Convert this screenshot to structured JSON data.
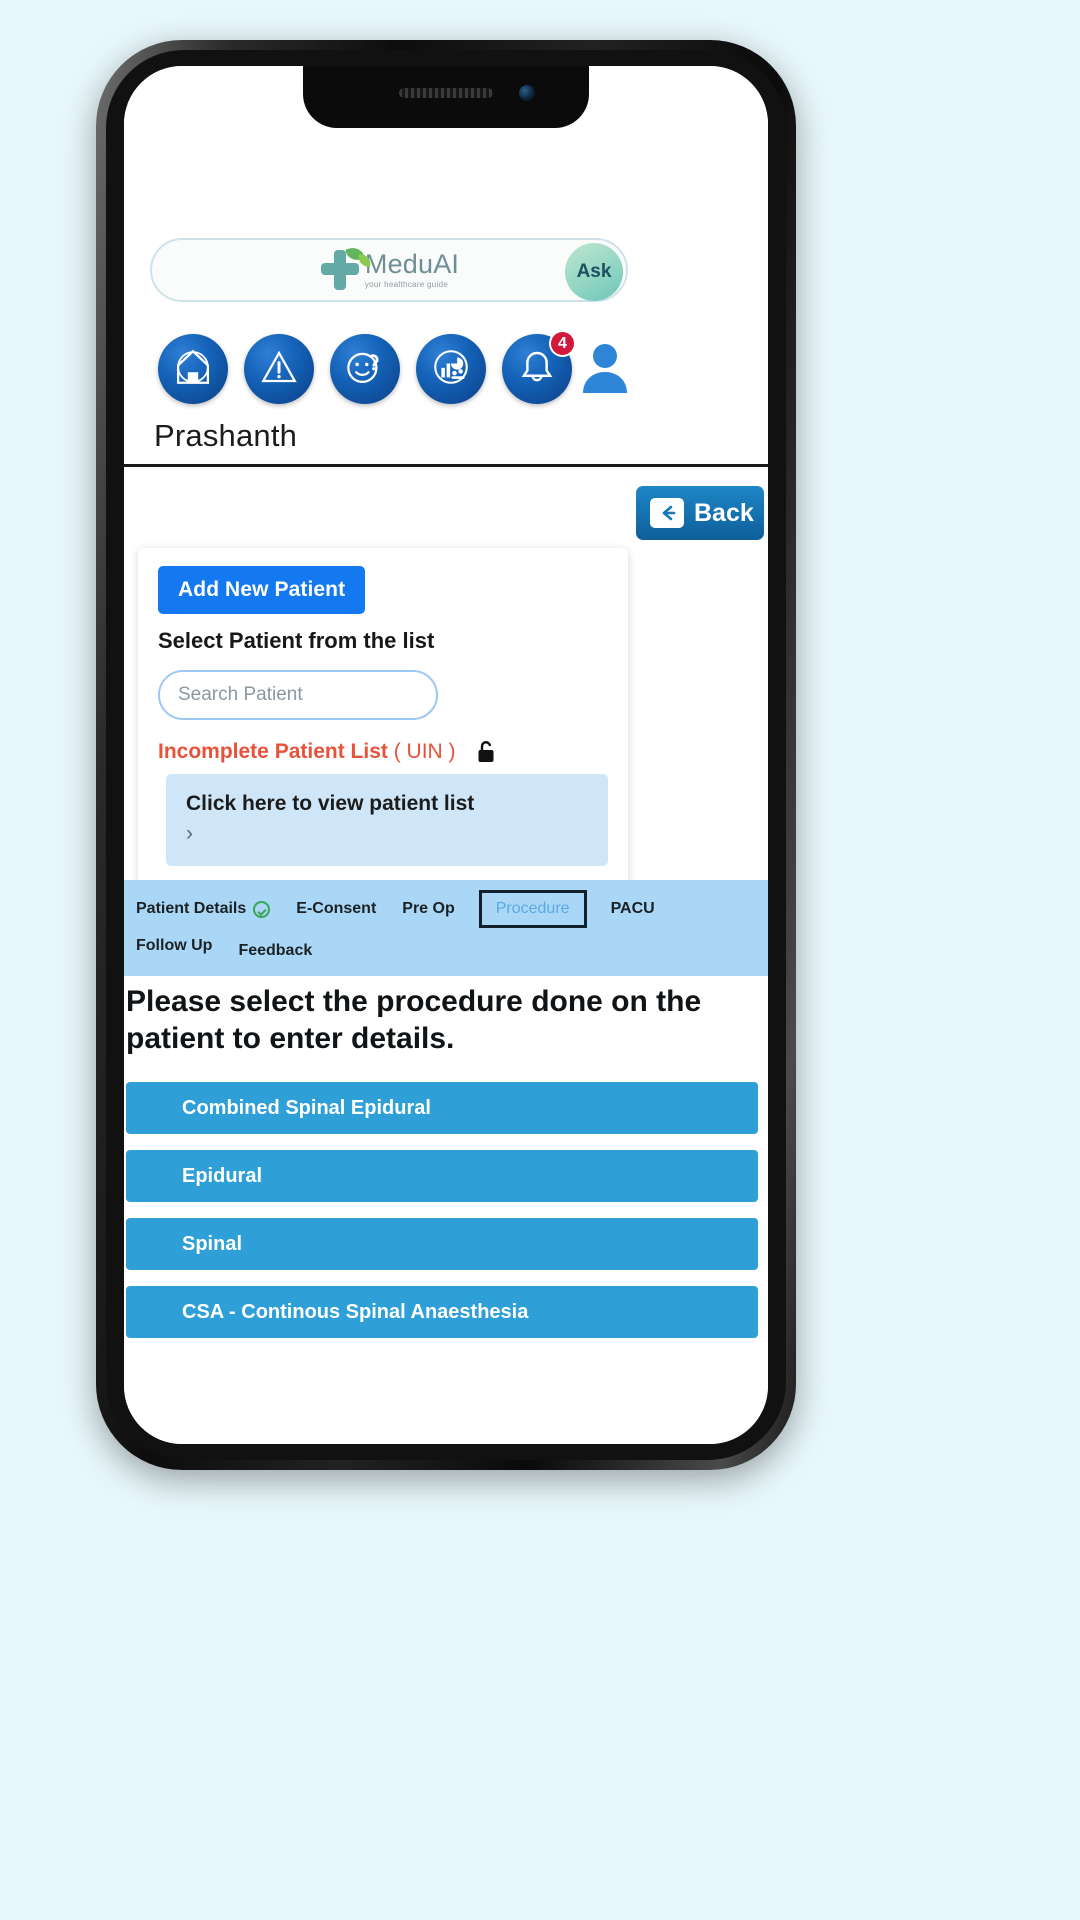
{
  "app": {
    "logo_name": "MeduAI",
    "logo_tagline": "your healthcare guide",
    "ask_label": "Ask"
  },
  "nav": {
    "items": [
      {
        "name": "home",
        "icon": "home-icon"
      },
      {
        "name": "alerts",
        "icon": "warning-triangle-icon"
      },
      {
        "name": "help",
        "icon": "smiley-question-icon"
      },
      {
        "name": "analytics",
        "icon": "chart-analytics-icon"
      },
      {
        "name": "notifications",
        "icon": "bell-icon",
        "badge": "4"
      }
    ],
    "profile_icon": "user-avatar-icon"
  },
  "user": {
    "name": "Prashanth"
  },
  "toolbar": {
    "back_label": "Back"
  },
  "patient_card": {
    "add_label": "Add New Patient",
    "select_label": "Select Patient from the list",
    "search_placeholder": "Search Patient",
    "search_value": "",
    "incomplete_label": "Incomplete Patient List",
    "incomplete_uin": "( UIN )",
    "lock_icon": "lock-icon",
    "list_box_label": "Click here to view patient list",
    "chevron": "›"
  },
  "tabs": [
    {
      "label": "Patient Details",
      "completed": true,
      "active": false
    },
    {
      "label": "E-Consent",
      "completed": false,
      "active": false
    },
    {
      "label": "Pre Op",
      "completed": false,
      "active": false
    },
    {
      "label": "Procedure",
      "completed": false,
      "active": true
    },
    {
      "label": "PACU",
      "completed": false,
      "active": false
    },
    {
      "label": "Follow Up",
      "completed": false,
      "active": false
    },
    {
      "label": "Feedback",
      "completed": false,
      "active": false
    }
  ],
  "main": {
    "prompt": "Please select the procedure done on the patient to enter details.",
    "procedures": [
      {
        "label": "Combined Spinal Epidural"
      },
      {
        "label": "Epidural"
      },
      {
        "label": "Spinal"
      },
      {
        "label": "CSA - Continous Spinal Anaesthesia"
      }
    ],
    "next_arrow": "→"
  },
  "colors": {
    "page_bg": "#e8f7fb",
    "primary_blue": "#1478f0",
    "procedure_blue": "#2f9fd8",
    "tabstrip_blue": "#aad7f5",
    "alert_red": "#e8523a",
    "badge_red": "#d0193b",
    "next_purple": "#4558c8",
    "deco_blue": "#4fb3e8"
  }
}
